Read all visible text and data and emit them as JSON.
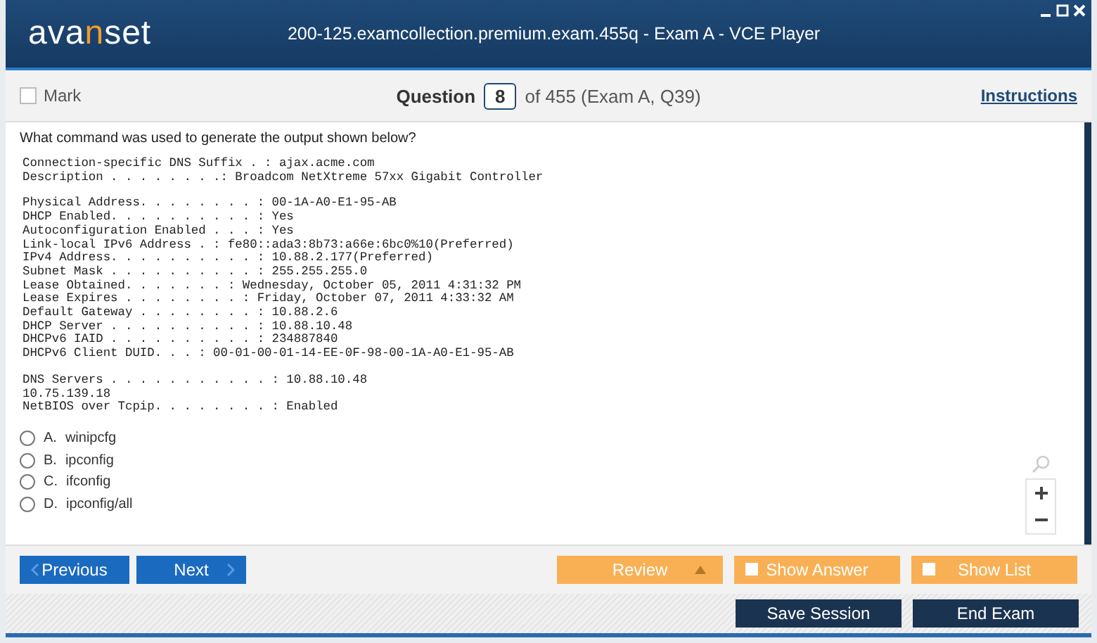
{
  "window": {
    "logo": [
      {
        "text": "ava",
        "accent": false
      },
      {
        "text": "n",
        "accent": true
      },
      {
        "text": "set",
        "accent": false
      }
    ],
    "title": "200-125.examcollection.premium.exam.455q - Exam A - VCE Player"
  },
  "header": {
    "mark": {
      "label": "Mark",
      "checked": false
    },
    "question_label": "Question",
    "question_number": "8",
    "question_of": "of 455 (Exam A, Q39)",
    "instructions": "Instructions"
  },
  "question": "What command was used to generate the output shown below?",
  "code_blocks": [
    [
      "Connection-specific DNS Suffix . : ajax.acme.com",
      "Description . . . . . . . .: Broadcom NetXtreme 57xx Gigabit Controller"
    ],
    [
      "Physical Address. . . . . . . . : 00-1A-A0-E1-95-AB",
      "DHCP Enabled. . . . . . . . . . : Yes",
      "Autoconfiguration Enabled . . . : Yes",
      "Link-local IPv6 Address . : fe80::ada3:8b73:a66e:6bc0%10(Preferred)",
      "IPv4 Address. . . . . . . . . . : 10.88.2.177(Preferred)",
      "Subnet Mask . . . . . . . . . . : 255.255.255.0",
      "Lease Obtained. . . . . . . : Wednesday, October 05, 2011 4:31:32 PM",
      "Lease Expires . . . . . . . . : Friday, October 07, 2011 4:33:32 AM",
      "Default Gateway . . . . . . . . : 10.88.2.6",
      "DHCP Server . . . . . . . . . . : 10.88.10.48",
      "DHCPv6 IAID . . . . . . . . . . : 234887840",
      "DHCPv6 Client DUID. . . : 00-01-00-01-14-EE-0F-98-00-1A-A0-E1-95-AB"
    ],
    [
      "DNS Servers . . . . . . . . . . . : 10.88.10.48",
      "10.75.139.18",
      "NetBIOS over Tcpip. . . . . . . . : Enabled"
    ]
  ],
  "options": [
    {
      "letter": "A.",
      "text": "winipcfg",
      "selected": false
    },
    {
      "letter": "B.",
      "text": "ipconfig",
      "selected": false
    },
    {
      "letter": "C.",
      "text": "ifconfig",
      "selected": false
    },
    {
      "letter": "D.",
      "text": "ipconfig/all",
      "selected": false
    }
  ],
  "nav": {
    "previous": "Previous",
    "next": "Next",
    "review": "Review",
    "show_answer": {
      "label": "Show Answer",
      "checked": false
    },
    "show_list": {
      "label": "Show List",
      "checked": false
    }
  },
  "footer": {
    "save": "Save Session",
    "end": "End Exam"
  }
}
